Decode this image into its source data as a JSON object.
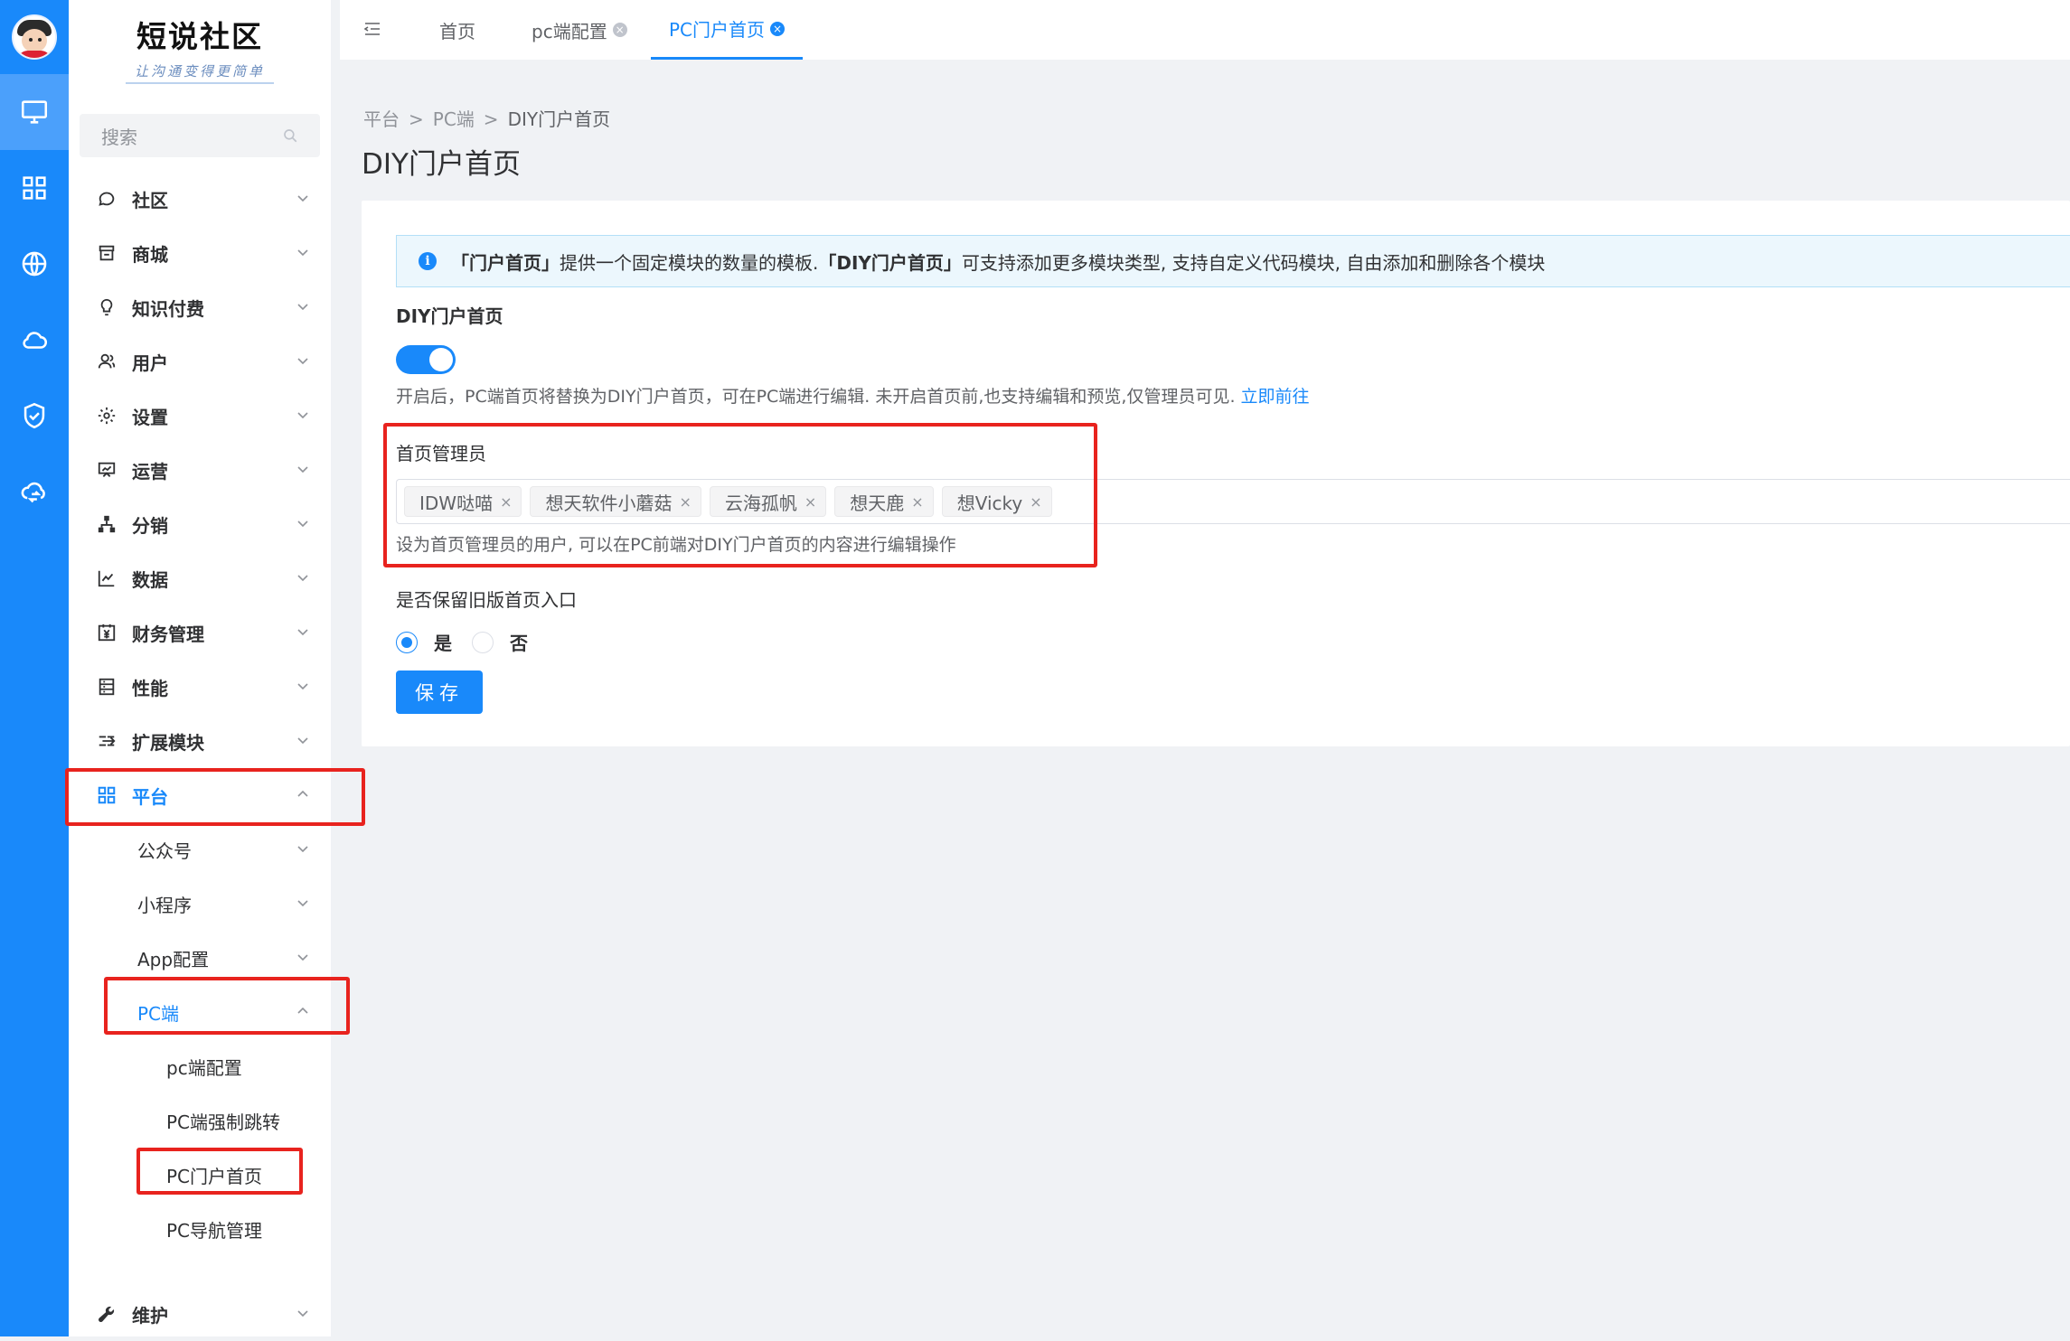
{
  "app": {
    "name": "短说社区",
    "slogan": "让沟通变得更简单"
  },
  "search": {
    "placeholder": "搜索"
  },
  "rail": {
    "icons": [
      "monitor-icon",
      "grid-icon",
      "globe-icon",
      "cloud-icon",
      "shield-check-icon",
      "cloud-sync-icon"
    ],
    "active": "monitor-icon"
  },
  "menu": {
    "items": [
      {
        "label": "社区",
        "icon": "chat-icon"
      },
      {
        "label": "商城",
        "icon": "store-icon"
      },
      {
        "label": "知识付费",
        "icon": "bulb-icon"
      },
      {
        "label": "用户",
        "icon": "user-icon"
      },
      {
        "label": "设置",
        "icon": "gear-icon"
      },
      {
        "label": "运营",
        "icon": "presentation-icon"
      },
      {
        "label": "分销",
        "icon": "hierarchy-icon"
      },
      {
        "label": "数据",
        "icon": "line-chart-icon"
      },
      {
        "label": "财务管理",
        "icon": "yuan-icon"
      },
      {
        "label": "性能",
        "icon": "server-icon"
      },
      {
        "label": "扩展模块",
        "icon": "extend-icon"
      },
      {
        "label": "平台",
        "icon": "platform-icon"
      }
    ],
    "platform_sub": [
      {
        "label": "公众号"
      },
      {
        "label": "小程序"
      },
      {
        "label": "App配置"
      },
      {
        "label": "PC端"
      }
    ],
    "pc_sub": [
      {
        "label": "pc端配置"
      },
      {
        "label": "PC端强制跳转"
      },
      {
        "label": "PC门户首页"
      },
      {
        "label": "PC导航管理"
      }
    ],
    "maintenance": {
      "label": "维护",
      "icon": "wrench-icon"
    }
  },
  "tabs": [
    {
      "label": "首页",
      "closable": false
    },
    {
      "label": "pc端配置",
      "closable": true
    },
    {
      "label": "PC门户首页",
      "closable": true,
      "active": true
    }
  ],
  "breadcrumb": [
    "平台",
    "PC端",
    "DIY门户首页"
  ],
  "breadcrumb_sep": ">",
  "page": {
    "title": "DIY门户首页",
    "alert": {
      "b1": "「门户首页」",
      "t1": "提供一个固定模块的数量的模板.",
      "b2": "「DIY门户首页」",
      "t2": "可支持添加更多模块类型, 支持自定义代码模块, 自由添加和删除各个模块"
    },
    "diy_label": "DIY门户首页",
    "diy_enabled": true,
    "diy_help": "开启后，PC端首页将替换为DIY门户首页，可在PC端进行编辑. 未开启首页前,也支持编辑和预览,仅管理员可见.",
    "diy_link": "立即前往",
    "admins_label": "首页管理员",
    "admins": [
      "IDW哒喵",
      "想天软件小蘑菇",
      "云海孤帆",
      "想天鹿",
      "想Vicky"
    ],
    "tag_close": "×",
    "admins_help": "设为首页管理员的用户, 可以在PC前端对DIY门户首页的内容进行编辑操作",
    "keep_old_label": "是否保留旧版首页入口",
    "options": [
      "是",
      "否"
    ],
    "selected_option": "是",
    "save_label": "保存"
  },
  "colors": {
    "primary": "#1989fa",
    "highlight": "#e8231e"
  }
}
